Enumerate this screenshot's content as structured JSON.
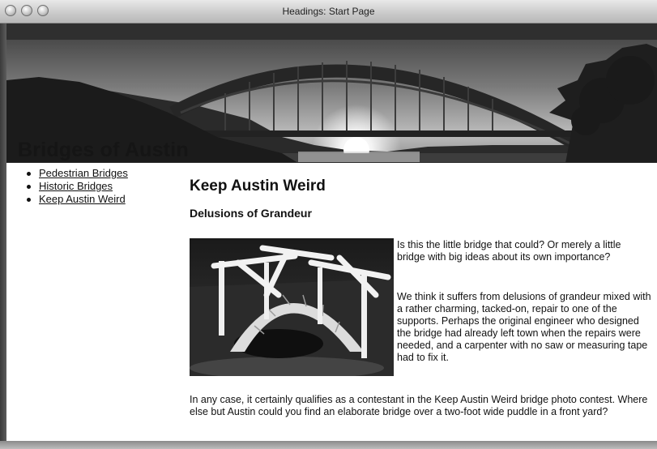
{
  "window": {
    "title": "Headings: Start Page"
  },
  "header": {
    "site_title": "Bridges of Austin"
  },
  "nav": {
    "items": [
      {
        "label": "Pedestrian Bridges"
      },
      {
        "label": "Historic Bridges"
      },
      {
        "label": "Keep Austin Weird"
      }
    ]
  },
  "main": {
    "heading": "Keep Austin Weird",
    "subheading": "Delusions of Grandeur",
    "paragraphs": [
      "Is this the little bridge that could? Or merely a little bridge with big ideas about its own importance?",
      "We think it suffers from delusions of grandeur mixed with a rather charming, tacked-on, repair to one of the supports. Perhaps the original engineer who designed the bridge had already left town when the repairs were needed, and a carpenter with no saw or measuring tape had to fix it.",
      "In any case, it certainly qualifies as a contestant in the Keep Austin Weird bridge photo contest. Where else but Austin could you find an elaborate bridge over a two-foot wide puddle in a front yard?"
    ]
  }
}
